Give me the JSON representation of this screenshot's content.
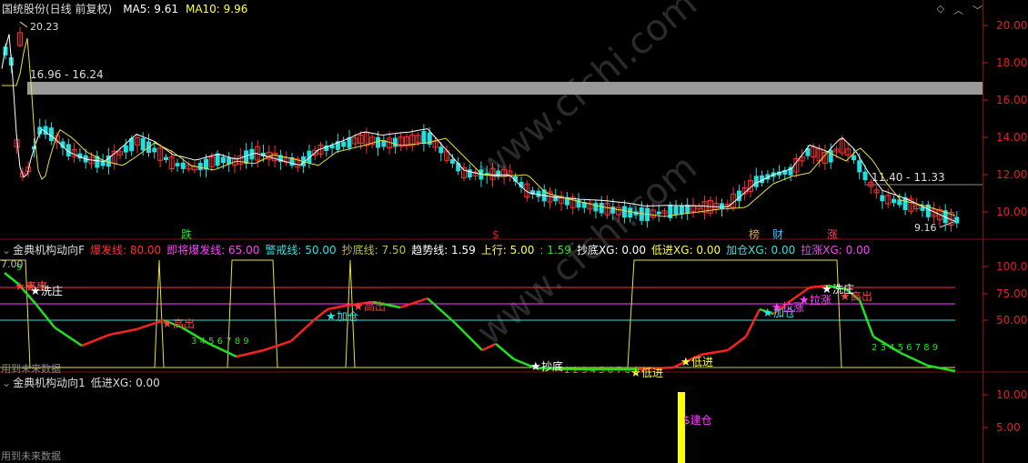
{
  "main_panel": {
    "title": "国统股份(日线 前复权)",
    "ma5_label": "MA5: 9.61",
    "ma10_label": "MA10: 9.96",
    "high_label": "20.23",
    "band_label": "16.96 - 16.24",
    "range_label2": "11.40 - 11.33",
    "low_label": "9.16",
    "y_ticks": [
      "20.00",
      "18.00",
      "16.00",
      "14.00",
      "12.00",
      "10.00"
    ],
    "events": [
      {
        "text": "跌",
        "color": "#20e020"
      },
      {
        "text": "$",
        "color": "#e02020"
      },
      {
        "text": "榜",
        "color": "#e0a040"
      },
      {
        "text": "财",
        "color": "#40c0ff"
      },
      {
        "text": "涨",
        "color": "#ff4060"
      }
    ],
    "window_icons": [
      "diamond-icon",
      "chevron-up-icon",
      "chevron-down-icon"
    ]
  },
  "indicator_panel": {
    "title": "金典机构动向F",
    "params": [
      {
        "text": "爆发线: 80.00",
        "color": "#ff3030"
      },
      {
        "text": "即将爆发线: 65.00",
        "color": "#ff40ff"
      },
      {
        "text": "警戒线: 50.00",
        "color": "#30e0e0"
      },
      {
        "text": "抄底线: 7.50",
        "color": "#c0c040"
      },
      {
        "text": "趋势线: 1.59",
        "color": "#ffffff"
      },
      {
        "text": "上行: 5.00",
        "color": "#ffff40"
      },
      {
        "text": ": 1.59",
        "color": "#30e030"
      },
      {
        "text": "抄底XG: 0.00",
        "color": "#ffffff"
      },
      {
        "text": "低进XG: 0.00",
        "color": "#ffff40"
      },
      {
        "text": "加仓XG: 0.00",
        "color": "#30e0e0"
      },
      {
        "text": "拉涨XG: 0.00",
        "color": "#ff40ff"
      }
    ],
    "y_ticks": [
      "100.0",
      "75.00",
      "50.00"
    ],
    "left_value": "7.00",
    "future_note": "用到未来数据",
    "signals": [
      {
        "text": "高出",
        "color": "#ff4040"
      },
      {
        "text": "庄",
        "color": "#ff4040"
      },
      {
        "text": "洗庄",
        "color": "#ffffff"
      },
      {
        "text": "高出",
        "color": "#ff4040"
      },
      {
        "text": "加仓",
        "color": "#30e0e0"
      },
      {
        "text": "高出",
        "color": "#ff4040"
      },
      {
        "text": "抄底",
        "color": "#ffffff"
      },
      {
        "text": "低进",
        "color": "#ffff40"
      },
      {
        "text": "低进",
        "color": "#ffff40"
      },
      {
        "text": "加仓",
        "color": "#30e0e0"
      },
      {
        "text": "拉涨",
        "color": "#ff40ff"
      },
      {
        "text": "拉涨",
        "color": "#ff40ff"
      },
      {
        "text": "洗庄",
        "color": "#ffffff"
      },
      {
        "text": "高出",
        "color": "#ff4040"
      }
    ],
    "step_labels_1": "3 4 5 6  7 8 9",
    "step_labels_2": "1 2 3 4 5 6 7 8 9",
    "step_labels_3": "2 3 4 5 6  7 8 9"
  },
  "lower_panel": {
    "title": "金典机构动向1",
    "value_label": "低进XG: 0.00",
    "y_ticks": [
      "10.00",
      "5.00"
    ],
    "future_note": "用到未来数据",
    "signal_text": "$建仓"
  },
  "watermark": "www.cfchi.com"
}
